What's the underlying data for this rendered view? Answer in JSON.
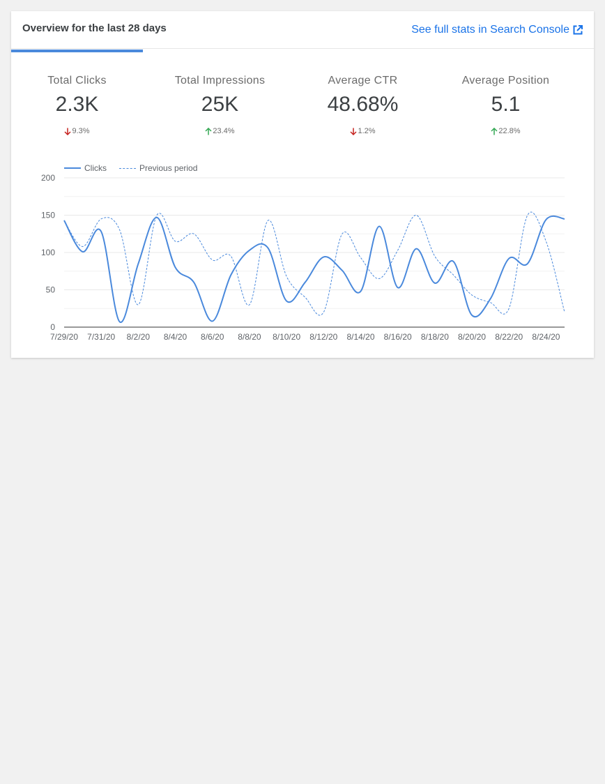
{
  "header": {
    "title": "Overview for the last 28 days",
    "link_label": "See full stats in Search Console"
  },
  "metrics": [
    {
      "label": "Total Clicks",
      "value": "2.3K",
      "change": "9.3%",
      "direction": "down",
      "active": true
    },
    {
      "label": "Total Impressions",
      "value": "25K",
      "change": "23.4%",
      "direction": "up",
      "active": false
    },
    {
      "label": "Average CTR",
      "value": "48.68%",
      "change": "1.2%",
      "direction": "down",
      "active": false
    },
    {
      "label": "Average Position",
      "value": "5.1",
      "change": "22.8%",
      "direction": "up",
      "active": false
    }
  ],
  "colors": {
    "accent": "#4a89dc",
    "link": "#1a73e8",
    "down": "#c5221f",
    "up": "#34a853"
  },
  "chart_data": {
    "type": "line",
    "x": [
      "7/29/20",
      "7/30/20",
      "7/31/20",
      "8/1/20",
      "8/2/20",
      "8/3/20",
      "8/4/20",
      "8/5/20",
      "8/6/20",
      "8/7/20",
      "8/8/20",
      "8/9/20",
      "8/10/20",
      "8/11/20",
      "8/12/20",
      "8/13/20",
      "8/14/20",
      "8/15/20",
      "8/16/20",
      "8/17/20",
      "8/18/20",
      "8/19/20",
      "8/20/20",
      "8/21/20",
      "8/22/20",
      "8/23/20",
      "8/24/20",
      "8/25/20"
    ],
    "x_tick_labels": [
      "7/29/20",
      "7/31/20",
      "8/2/20",
      "8/4/20",
      "8/6/20",
      "8/8/20",
      "8/10/20",
      "8/12/20",
      "8/14/20",
      "8/16/20",
      "8/18/20",
      "8/20/20",
      "8/22/20",
      "8/24/20"
    ],
    "ylim": [
      0,
      200
    ],
    "y_ticks": [
      0,
      50,
      100,
      150,
      200
    ],
    "grid": true,
    "legend_position": "top-left",
    "series": [
      {
        "name": "Clicks",
        "style": "solid",
        "values": [
          143,
          101,
          128,
          7,
          85,
          147,
          80,
          60,
          8,
          70,
          103,
          106,
          35,
          60,
          94,
          76,
          48,
          135,
          53,
          105,
          59,
          88,
          16,
          38,
          92,
          85,
          144,
          145
        ]
      },
      {
        "name": "Previous period",
        "style": "dashed",
        "values": [
          143,
          108,
          145,
          130,
          30,
          150,
          115,
          125,
          90,
          95,
          30,
          143,
          68,
          40,
          20,
          125,
          93,
          65,
          103,
          150,
          95,
          70,
          43,
          33,
          25,
          150,
          115,
          20
        ]
      }
    ]
  }
}
